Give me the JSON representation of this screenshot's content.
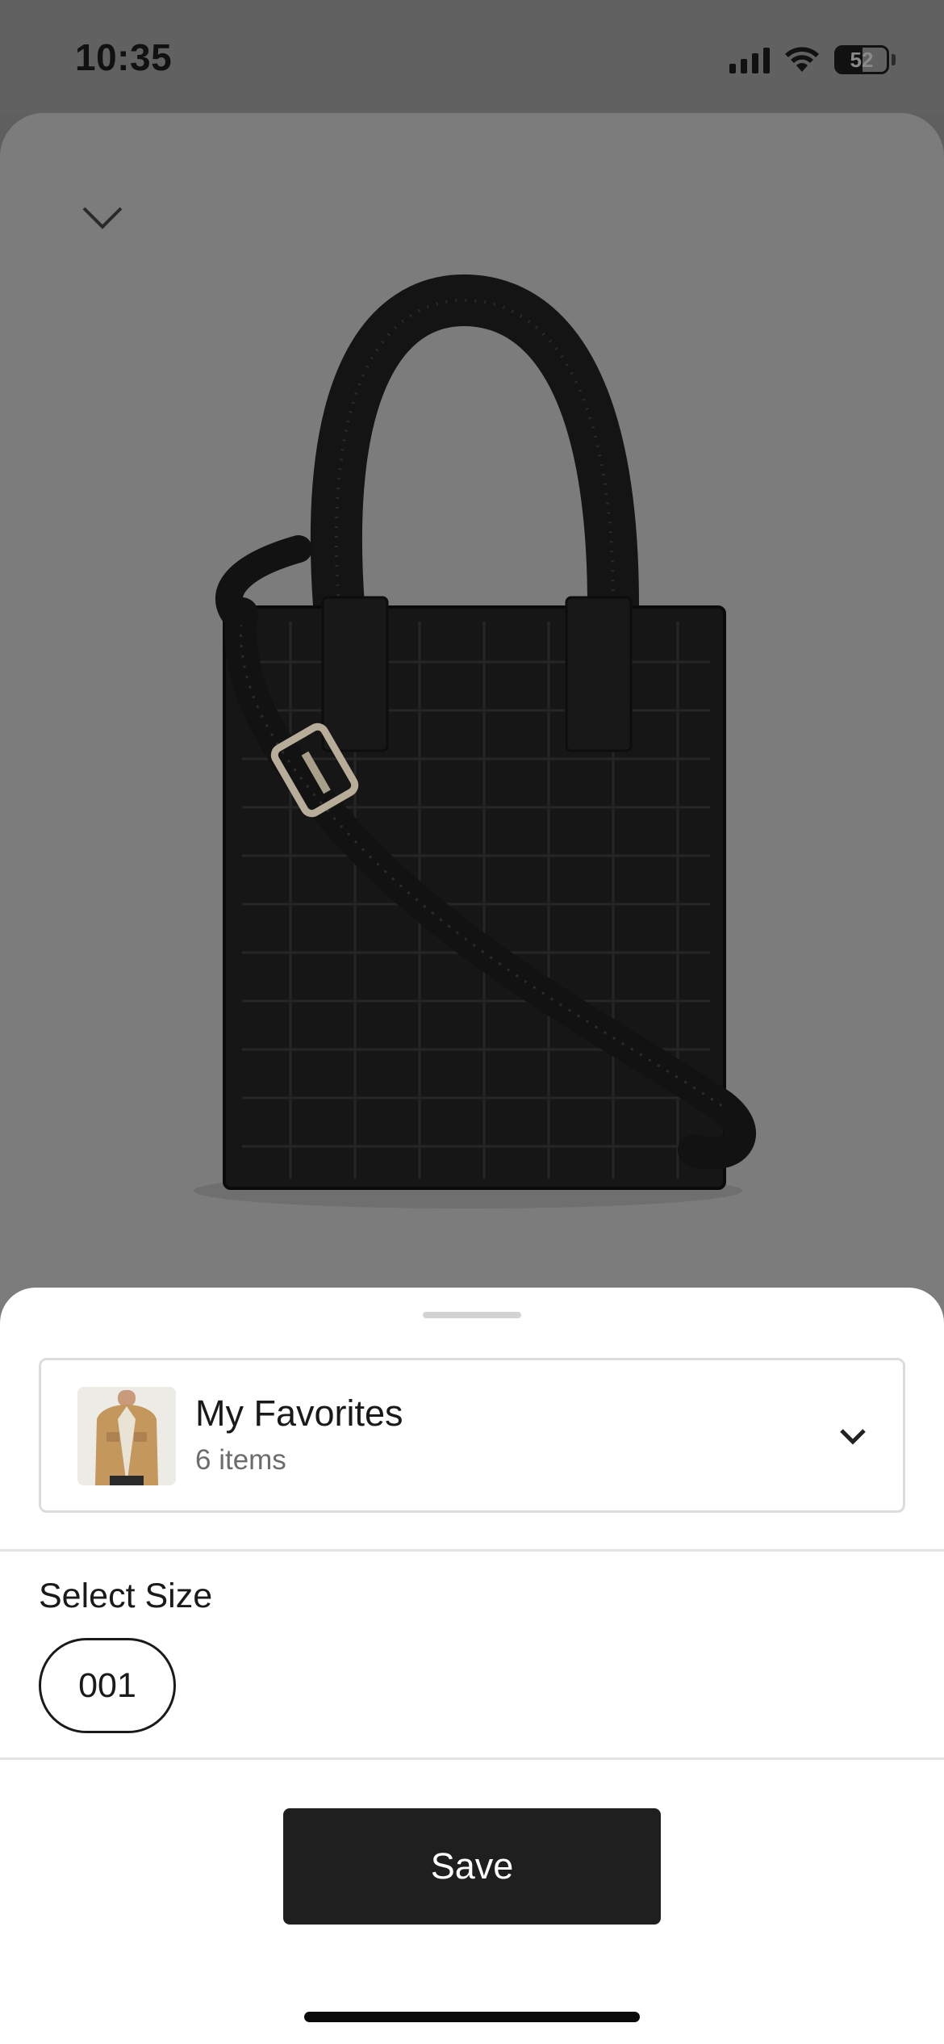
{
  "status_bar": {
    "time": "10:35",
    "battery_level": "52",
    "battery_fraction": 0.52,
    "icons": [
      "cellular-signal-icon",
      "wifi-icon",
      "battery-icon"
    ]
  },
  "product": {
    "image": "black-mini-tote-bag-image",
    "collapse_icon": "chevron-down-icon"
  },
  "sheet": {
    "wishlist": {
      "name": "My Favorites",
      "count": "6 items",
      "thumbnail": "tan-jacket-thumbnail",
      "dropdown_icon": "chevron-down-icon"
    },
    "size_section": {
      "title": "Select Size",
      "options": [
        "001"
      ],
      "selected": "001"
    },
    "save_label": "Save"
  },
  "colors": {
    "overlay": "#7c7c7c",
    "status_bar": "#616161",
    "sheet_bg": "#ffffff",
    "button_bg": "#1f1f1f",
    "button_text": "#ffffff",
    "border": "#dcdcdc"
  }
}
